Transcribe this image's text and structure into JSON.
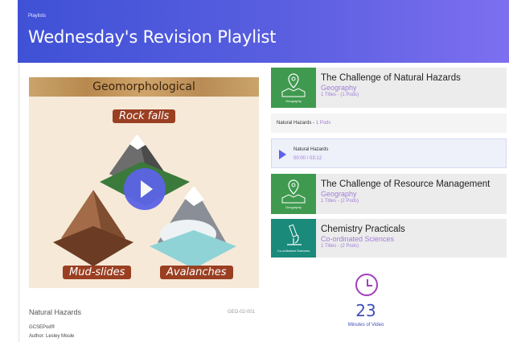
{
  "header": {
    "crumb": "Playlists",
    "title": "Wednesday's Revision Playlist"
  },
  "player": {
    "banner": "Geomorphological",
    "labels": [
      "Rock falls",
      "Mud-slides",
      "Avalanches"
    ]
  },
  "video": {
    "title": "Natural Hazards",
    "code": "GEO-02-001",
    "brand": "GCSEPod®",
    "author": "Author: Lesley Moule"
  },
  "cards": [
    {
      "title": "The Challenge of Natural Hazards",
      "subject": "Geography",
      "count": "1 Titles - (1 Pods)",
      "thumb": "Geography"
    },
    {
      "title": "The Challenge of Resource Management",
      "subject": "Geography",
      "count": "1 Titles - (2 Pods)",
      "thumb": "Geography"
    },
    {
      "title": "Chemistry Practicals",
      "subject": "Co-ordinated Sciences",
      "count": "1 Titles - (2 Pods)",
      "thumb": "Co-ordinated Sciences"
    }
  ],
  "pod_row": {
    "label": "Natural Hazards - ",
    "pods": "1 Pods"
  },
  "now_playing": {
    "title": "Natural Hazards",
    "time": "00:00 / 03:12"
  },
  "stats": {
    "minutes": "23",
    "label": "Minutes of Video"
  },
  "colors": {
    "header_start": "#3f51d6",
    "header_end": "#7d6ff0",
    "accent_purple": "#a07ed8",
    "geo_green": "#3f9a4f",
    "sci_teal": "#1a8a7a"
  },
  "icons": {
    "play": "play-icon",
    "map_pin": "map-pin-icon",
    "microscope": "microscope-icon",
    "clock": "clock-icon"
  }
}
